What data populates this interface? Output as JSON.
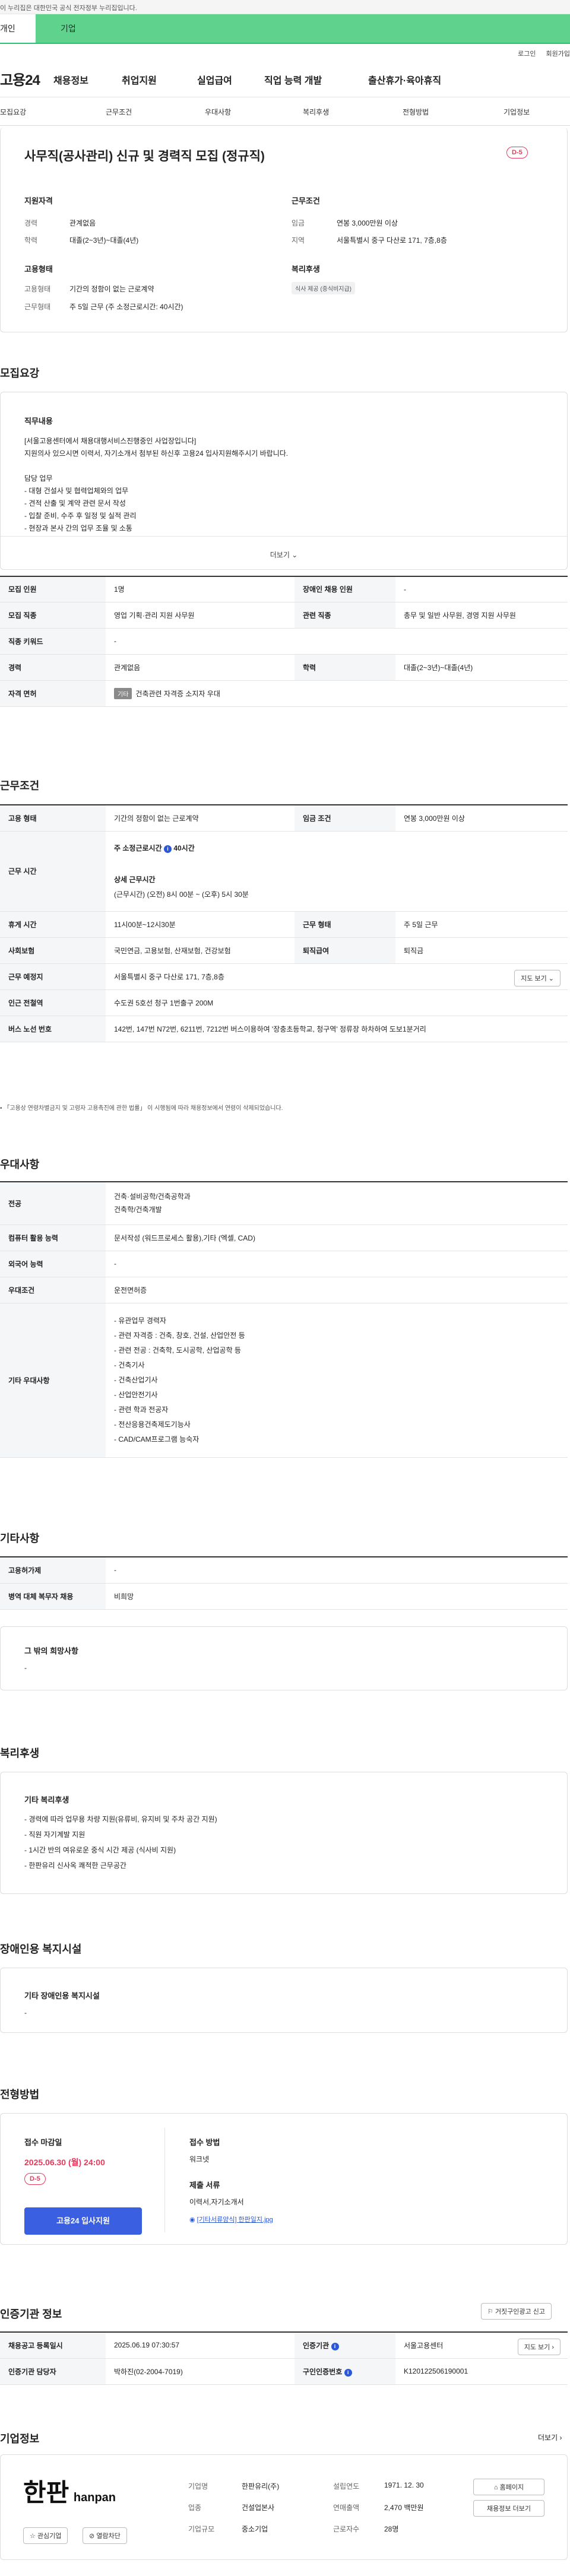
{
  "gov_banner": "이 누리집은 대한민국 공식 전자정부 누리집입니다.",
  "top_tabs": {
    "individual": "개인",
    "business": "기업"
  },
  "util": {
    "login": "로그인",
    "join": "회원가입"
  },
  "logo": "고용24",
  "nav": [
    "채용정보",
    "취업지원",
    "실업급여",
    "직업 능력 개발",
    "출산휴가·육아휴직"
  ],
  "subnav": [
    "모집요강",
    "근무조건",
    "우대사항",
    "복리후생",
    "전형방법",
    "기업정보"
  ],
  "job": {
    "title": "사무직(공사관리) 신규 및 경력직 모집 (정규직)",
    "dday": "D-5",
    "qual_title": "지원자격",
    "career_label": "경력",
    "career": "관계없음",
    "edu_label": "학력",
    "edu": "대졸(2~3년)~대졸(4년)",
    "emp_title": "고용형태",
    "emp_type_label": "고용형태",
    "emp_type": "기간의 정함이 없는 근로계약",
    "work_time_label": "근무형태",
    "work_time": "주 5일 근무 (주 소정근로시간: 40시간)",
    "cond_title": "근무조건",
    "wage_label": "임금",
    "wage": "연봉 3,000만원 이상",
    "area_label": "지역",
    "area": "서울특별시 중구 다산로 171, 7층,8층",
    "welfare_title": "복리후생",
    "welfare_chip": "식사 제공 (중식비지급)"
  },
  "recruit": {
    "title": "모집요강",
    "duty_title": "직무내용",
    "duty_lines": [
      "[서울고용센터에서 채용대행서비스진행중인 사업장입니다]",
      "지원의사 있으시면 이력서, 자기소개서 첨부된 하신후 고용24 입사지원해주시기 바랍니다.",
      "",
      "담당 업무",
      "- 대형 건설사 및 협력업체와의 업무",
      "- 견적 산출 및 계약 관련 문서 작성",
      "- 입찰 준비, 수주 후 일정 및 실적 관리",
      "- 현장과 본사 간의 업무 조율 및 소통"
    ],
    "more": "더보기",
    "r1a": "모집 인원",
    "r1b": "1명",
    "r1c": "장애인 채용 인원",
    "r1d": "-",
    "r2a": "모집 직종",
    "r2b": "영업 기획·관리 지원 사무원",
    "r2c": "관련 직종",
    "r2d": "총무 및 일반 사무원, 경영 지원 사무원",
    "r3a": "직종 키워드",
    "r3b": "-",
    "r4a": "경력",
    "r4b": "관계없음",
    "r4c": "학력",
    "r4d": "대졸(2~3년)~대졸(4년)",
    "r5a": "자격 면허",
    "r5tag": "기타",
    "r5b": "건축관련 자격증 소지자 우대"
  },
  "conditions": {
    "title": "근무조건",
    "r1a": "고용 형태",
    "r1b": "기간의 정함이 없는 근로계약",
    "r1c": "임금 조건",
    "r1d": "연봉 3,000만원 이상",
    "r2a": "근무 시간",
    "r2b": "주 소정근로시간",
    "r2b2": "40시간",
    "r2c": "상세 근무시간",
    "r2d": "(근무시간) (오전) 8시 00분 ~ (오후) 5시 30분",
    "r3a": "휴게 시간",
    "r3b": "11시00분~12시30분",
    "r3c": "근무 형태",
    "r3d": "주 5일 근무",
    "r4a": "사회보험",
    "r4b": "국민연금, 고용보험, 산재보험, 건강보험",
    "r4c": "퇴직급여",
    "r4d": "퇴직금",
    "r5a": "근무 예정지",
    "r5b": "서울특별시 중구 다산로 171, 7층,8층",
    "r5btn": "지도 보기",
    "r6a": "인근 전철역",
    "r6b": "수도권 5호선 청구 1번출구 200M",
    "r7a": "버스 노선 번호",
    "r7b": "142번, 147번 N72번, 6211번, 7212번 버스이용하여 '장충초등학교, 청구역' 정류장 하차하여 도보1분거리",
    "note": "「고용상 연령차별금지 및 고령자 고용촉진에 관한 법률」 이 시행됨에 따라 채용정보에서 연령이 삭제되었습니다."
  },
  "pref": {
    "title": "우대사항",
    "r1a": "전공",
    "r1b": "건축·설비공학/건축공학과",
    "r1b2": "건축학/건축개발",
    "r2a": "컴퓨터 활용 능력",
    "r2b": "문서작성 (워드프로세스 활용),기타 (엑셀, CAD)",
    "r3a": "외국어 능력",
    "r3b": "-",
    "r4a": "우대조건",
    "r4b": "운전면허증",
    "r5a": "기타 우대사항",
    "r5list": [
      "- 유관업무 경력자",
      "- 관련 자격증 : 건축, 창호, 건설, 산업안전 등",
      "- 관련 전공 : 건축학, 도시공학, 산업공학 등",
      "- 건축기사",
      "- 건축산업기사",
      "- 산업안전기사",
      "- 관련 학과 전공자",
      "- 전산응용건축제도기능사",
      "- CAD/CAM프로그램 능숙자"
    ]
  },
  "etc": {
    "title": "기타사항",
    "r1a": "고용허가제",
    "r1b": "-",
    "r2a": "병역 대체 복무자 채용",
    "r2b": "비희망",
    "hope_title": "그 밖의 희망사항",
    "hope": "-"
  },
  "welfare": {
    "title": "복리후생",
    "box_title": "기타 복리후생",
    "lines": [
      "- 경력에 따라 업무용 차량 지원(유류비, 유지비 및 주차 공간 지원)",
      "- 직원 자기계발 지원",
      "- 1시간 반의 여유로운 중식 시간 제공 (식사비 지원)",
      "- 한판유리 신사옥 쾌적한 근무공간"
    ]
  },
  "disabled": {
    "title": "장애인용 복지시설",
    "box_title": "기타 장애인용 복지시설",
    "value": "-"
  },
  "process": {
    "title": "전형방법",
    "deadline_label": "접수 마감일",
    "deadline": "2025.06.30 (월) 24:00",
    "dday": "D-5",
    "apply": "고용24 입사지원",
    "method_label": "접수 방법",
    "method": "워크넷",
    "docs_label": "제출 서류",
    "docs": "이력서,자기소개서",
    "file": "[기타서류양식] 한판일지.jpg"
  },
  "agency": {
    "title": "인증기관 정보",
    "report": "거짓구인광고 신고",
    "r1a": "채용공고 등록일시",
    "r1b": "2025.06.19 07:30:57",
    "r1c": "인증기관",
    "r1d": "서울고용센터",
    "r1btn": "지도 보기",
    "r2a": "인증기관 담당자",
    "r2b": "박하진(02-2004-7019)",
    "r2c": "구인인증번호",
    "r2d": "K120122506190001"
  },
  "company": {
    "title": "기업정보",
    "more": "더보기",
    "logo_big": "한판",
    "logo_small": "hanpan",
    "interest": "관심기업",
    "block": "열람차단",
    "c1a": "기업명",
    "c1b": "한판유리(주)",
    "c2a": "업종",
    "c2b": "건설업본사",
    "c3a": "기업규모",
    "c3b": "중소기업",
    "d1a": "설립연도",
    "d1b": "1971. 12. 30",
    "d2a": "연매출액",
    "d2b": "2,470 백만원",
    "d3a": "근로자수",
    "d3b": "28명",
    "homepage": "홈페이지",
    "other_jobs": "채용정보 더보기"
  }
}
